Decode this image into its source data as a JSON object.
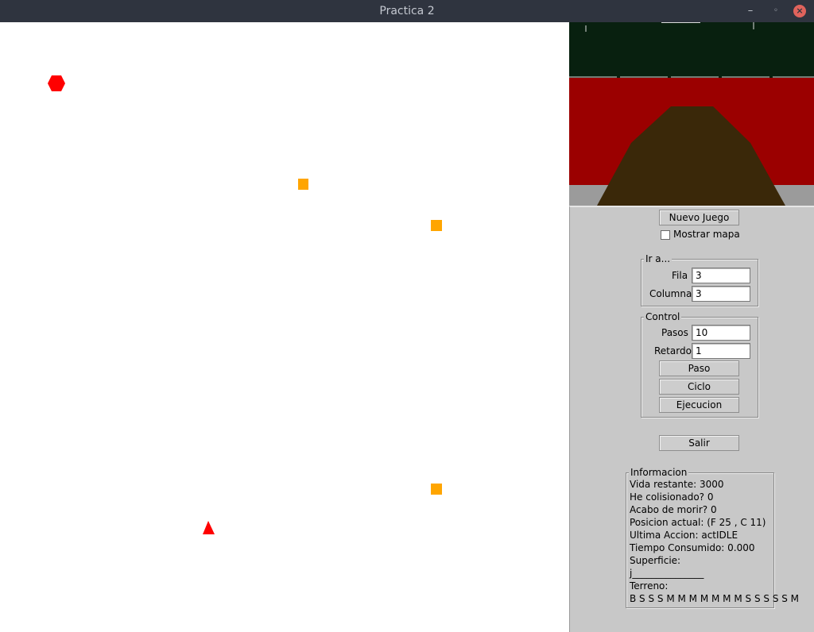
{
  "window": {
    "title": "Practica 2",
    "minimize_glyph": "–",
    "maximize_glyph": "◦",
    "close_glyph": "×"
  },
  "map": {
    "agent_color": "#ff0000",
    "item_color": "#ffa500"
  },
  "view3d": {
    "sky_color": "#08200f",
    "far_color": "#9b0000",
    "ground_color": "#3a2809",
    "side_color": "#9b9b9b"
  },
  "controls": {
    "new_game_label": "Nuevo Juego",
    "show_map_label": "Mostrar mapa",
    "goto": {
      "legend": "Ir a...",
      "row_label": "Fila",
      "row_value": "3",
      "col_label": "Columna",
      "col_value": "3"
    },
    "control": {
      "legend": "Control",
      "steps_label": "Pasos",
      "steps_value": "10",
      "delay_label": "Retardo",
      "delay_value": "1",
      "step_button": "Paso",
      "cycle_button": "Ciclo",
      "run_button": "Ejecucion"
    },
    "exit_label": "Salir"
  },
  "info": {
    "legend": "Informacion",
    "lines": [
      "Vida restante: 3000",
      "He colisionado? 0",
      "Acabo de morir? 0",
      "Posicion actual: (F 25 , C 11)",
      "Ultima Accion: actIDLE",
      "Tiempo Consumido: 0.000",
      "Superficie:",
      "j_______________",
      "Terreno:",
      "B S S S M M M M M M M S S S S S M"
    ]
  }
}
